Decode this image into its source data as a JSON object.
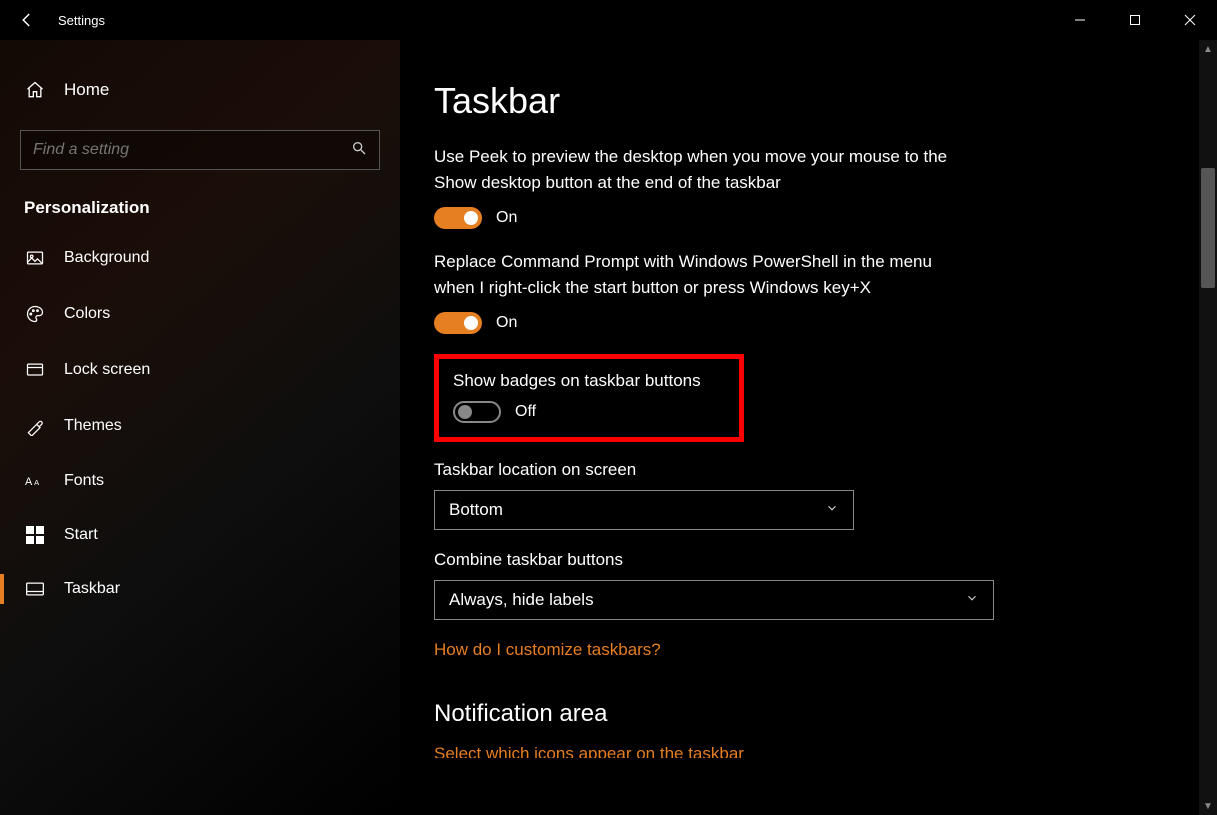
{
  "titlebar": {
    "title": "Settings"
  },
  "sidebar": {
    "home": "Home",
    "search_placeholder": "Find a setting",
    "section": "Personalization",
    "items": [
      {
        "label": "Background"
      },
      {
        "label": "Colors"
      },
      {
        "label": "Lock screen"
      },
      {
        "label": "Themes"
      },
      {
        "label": "Fonts"
      },
      {
        "label": "Start"
      },
      {
        "label": "Taskbar"
      }
    ]
  },
  "page": {
    "title": "Taskbar",
    "peek_desc": "Use Peek to preview the desktop when you move your mouse to the Show desktop button at the end of the taskbar",
    "peek_state": "On",
    "powershell_desc": "Replace Command Prompt with Windows PowerShell in the menu when I right-click the start button or press Windows key+X",
    "powershell_state": "On",
    "badges_label": "Show badges on taskbar buttons",
    "badges_state": "Off",
    "location_label": "Taskbar location on screen",
    "location_value": "Bottom",
    "combine_label": "Combine taskbar buttons",
    "combine_value": "Always, hide labels",
    "help_link": "How do I customize taskbars?",
    "notif_heading": "Notification area",
    "notif_link": "Select which icons appear on the taskbar"
  }
}
